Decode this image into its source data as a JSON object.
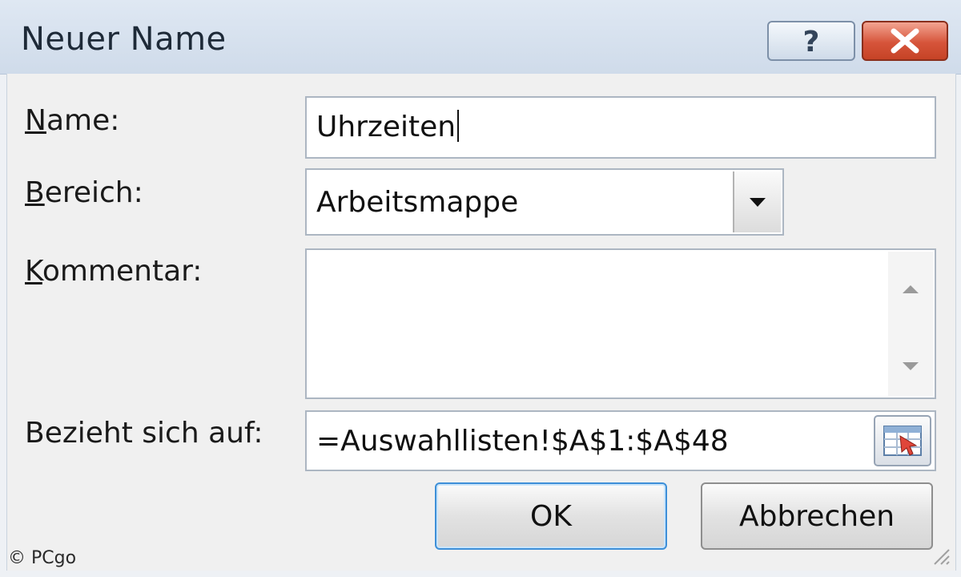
{
  "dialog": {
    "title": "Neuer Name",
    "help_icon": "question-mark-icon",
    "close_icon": "close-x-icon"
  },
  "fields": {
    "name": {
      "label": "Name:",
      "accelerator": "N",
      "value": "Uhrzeiten"
    },
    "bereich": {
      "label": "Bereich:",
      "accelerator": "B",
      "value": "Arbeitsmappe"
    },
    "kommentar": {
      "label": "Kommentar:",
      "accelerator": "K",
      "value": ""
    },
    "bezieht": {
      "label": "Bezieht sich auf:",
      "value": "=Auswahllisten!$A$1:$A$48"
    }
  },
  "buttons": {
    "ok": "OK",
    "cancel": "Abbrechen"
  },
  "watermark": "© PCgo",
  "colors": {
    "close_button": "#d6543a",
    "default_button_border": "#3d8fd8",
    "titlebar": "#cfdbea"
  }
}
